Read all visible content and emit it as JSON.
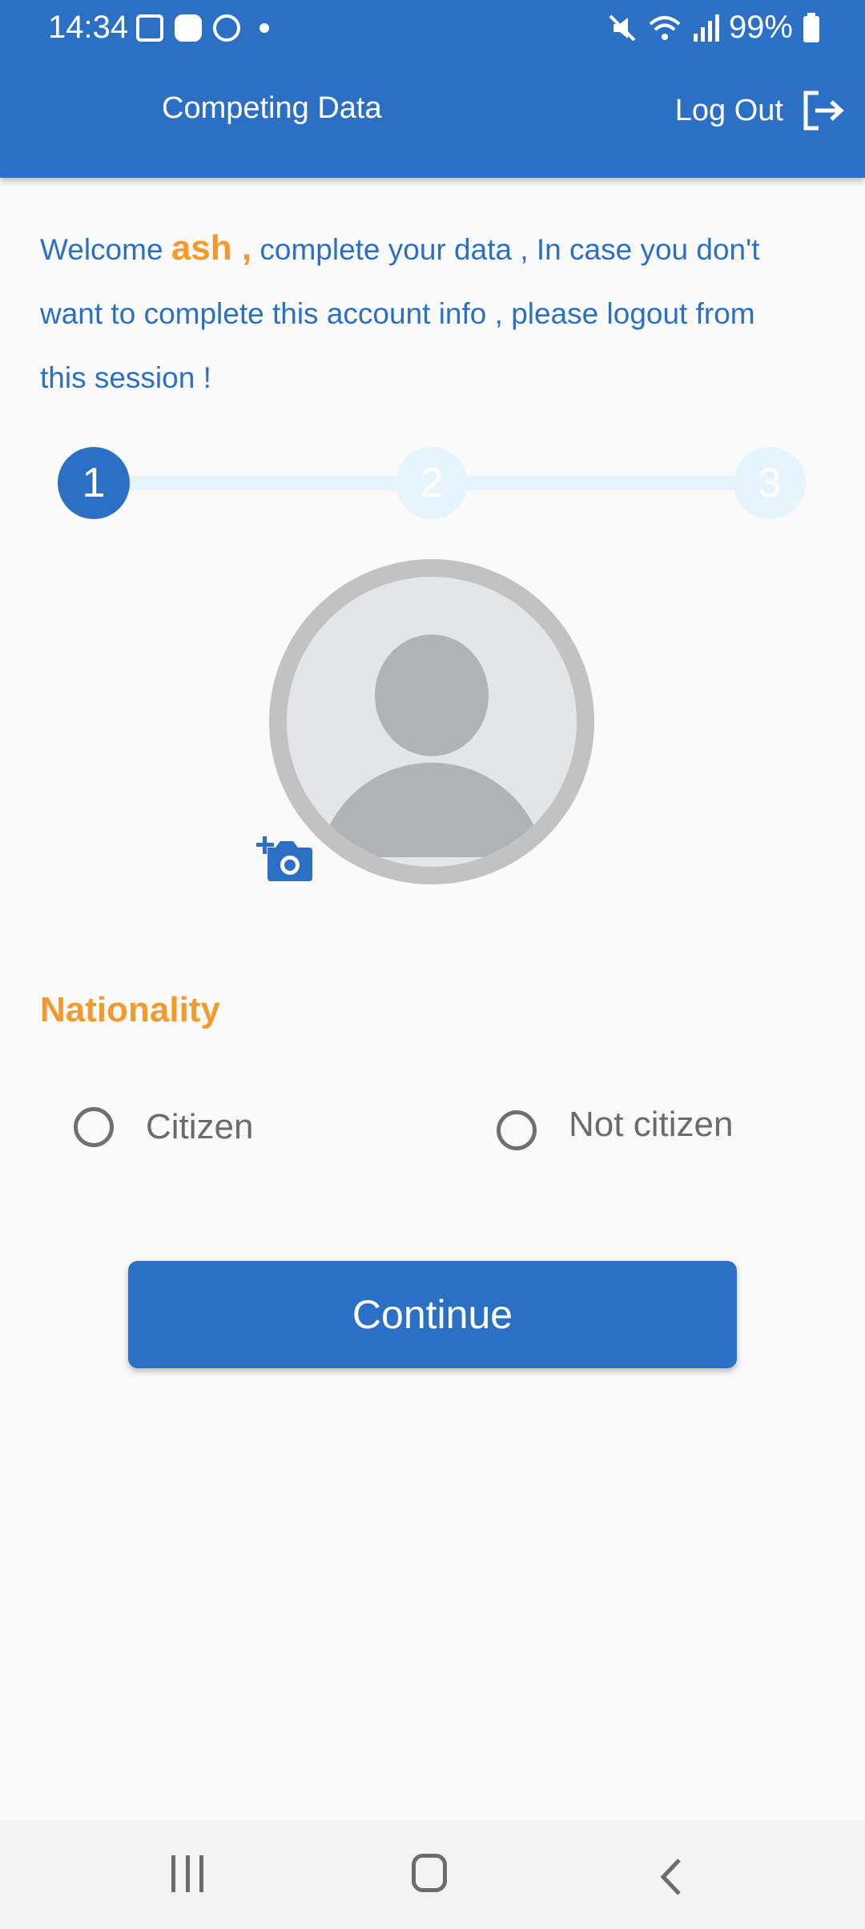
{
  "status_bar": {
    "time": "14:34",
    "battery": "99%"
  },
  "appbar": {
    "title": "Competing Data",
    "logout_label": "Log Out"
  },
  "welcome": {
    "prefix": "Welcome ",
    "name": "ash ,",
    "suffix": " complete your data , In case you don't want to complete this account info , please logout from this session !"
  },
  "stepper": {
    "steps": [
      "1",
      "2",
      "3"
    ],
    "current": 1
  },
  "nationality": {
    "label": "Nationality",
    "options": [
      "Citizen",
      "Not citizen"
    ]
  },
  "continue_label": "Continue",
  "colors": {
    "primary": "#2b70c4",
    "accent": "#f39a2c",
    "step_idle": "#e6f4fb"
  }
}
